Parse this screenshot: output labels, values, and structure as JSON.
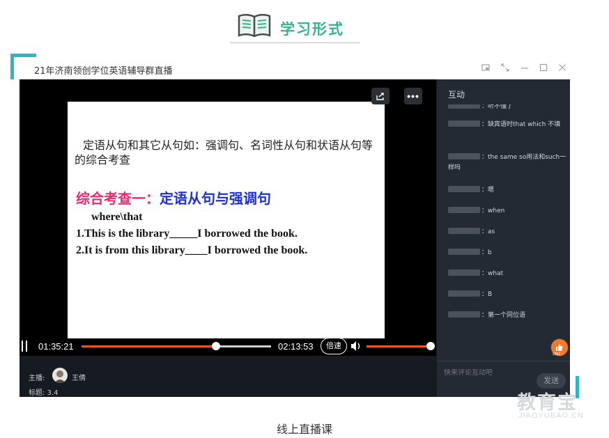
{
  "header": {
    "title": "学习形式",
    "icon": "book-icon",
    "accent": "#35b28f"
  },
  "window": {
    "title": "21年济南领创学位英语辅导群直播",
    "buttons": [
      "pip-icon",
      "fullscreen-icon",
      "minimize-icon",
      "maximize-icon",
      "close-icon"
    ]
  },
  "slide": {
    "intro": "定语从句和其它从句如：强调句、名词性从句和状语从句等的综合考查",
    "heading_part1": "综合考查一：",
    "heading_part2": "定语从句与强调句",
    "line1": "where\\that",
    "line2": "1.This is the library_____I borrowed the book.",
    "line3": "2.It is from this library____I borrowed the book."
  },
  "video_buttons": {
    "share": "share-icon",
    "more": "•••"
  },
  "controls": {
    "current_time": "01:35:21",
    "duration": "02:13:53",
    "progress": 0.711,
    "speed_label": "倍速",
    "volume": 1.0
  },
  "host": {
    "label": "主播:",
    "name": "王倩",
    "tag_label": "标题: 3.4"
  },
  "panel": {
    "title": "互动",
    "messages": [
      {
        "text": "：听不懂了"
      },
      {
        "text": "：缺宾语时that which 不填"
      },
      {
        "text": "：the same so用法和such一样吗"
      },
      {
        "text": "：嗯"
      },
      {
        "text": "：when"
      },
      {
        "text": "：as"
      },
      {
        "text": "：b"
      },
      {
        "text": "：what"
      },
      {
        "text": "：B"
      },
      {
        "text": "：第一个同位语"
      }
    ],
    "like_count": "2053",
    "comment_placeholder": "快来评论互动吧",
    "send_label": "发送"
  },
  "watermark": {
    "text": "教育宝",
    "url": "JIAOYUBAO.CN"
  },
  "caption": "线上直播课"
}
